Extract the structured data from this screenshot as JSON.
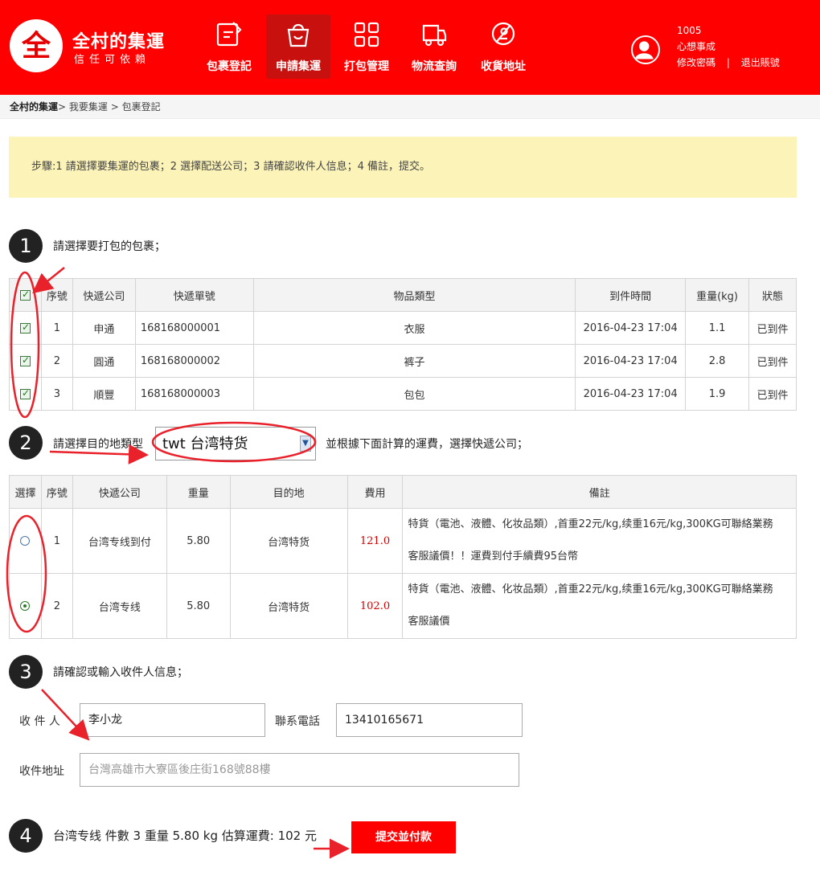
{
  "header": {
    "logo_glyph": "全",
    "logo_title": "全村的集運",
    "logo_slogan": "信任可依賴",
    "nav": [
      {
        "label": "包裹登記",
        "icon": "edit-icon"
      },
      {
        "label": "申請集運",
        "icon": "bag-icon"
      },
      {
        "label": "打包管理",
        "icon": "grid-icon"
      },
      {
        "label": "物流查詢",
        "icon": "truck-icon"
      },
      {
        "label": "收貨地址",
        "icon": "location-icon"
      }
    ],
    "active_nav": "申請集運",
    "user": {
      "id": "1005",
      "motto": "心想事成",
      "change_password": "修改密碼",
      "separator": "|",
      "logout": "退出賬號"
    },
    "avatar_icon": "user-avatar-icon"
  },
  "breadcrumb": {
    "home": "全村的集運",
    "path": "> 我要集運 > 包裹登記"
  },
  "notice": "步驟:1 請選擇要集運的包裹；2 選擇配送公司；3 請確認收件人信息；4 備註，提交。",
  "steps": {
    "s1": {
      "num": "1",
      "text": "請選擇要打包的包裹；"
    },
    "s2": {
      "num": "2",
      "text_before": "請選擇目的地類型",
      "text_after": "並根據下面計算的運費，選擇快遞公司；"
    },
    "s3": {
      "num": "3",
      "text": "請確認或輸入收件人信息；"
    },
    "s4": {
      "num": "4"
    }
  },
  "packages": {
    "headers": [
      "序號",
      "快遞公司",
      "快遞單號",
      "物品類型",
      "到件時間",
      "重量(kg)",
      "狀態"
    ],
    "rows": [
      {
        "no": "1",
        "courier": "申通",
        "tracking": "168168000001",
        "type": "衣服",
        "arrived": "2016-04-23 17:04",
        "weight": "1.1",
        "status": "已到件",
        "checked": true
      },
      {
        "no": "2",
        "courier": "圓通",
        "tracking": "168168000002",
        "type": "裤子",
        "arrived": "2016-04-23 17:04",
        "weight": "2.8",
        "status": "已到件",
        "checked": true
      },
      {
        "no": "3",
        "courier": "順豐",
        "tracking": "168168000003",
        "type": "包包",
        "arrived": "2016-04-23 17:04",
        "weight": "1.9",
        "status": "已到件",
        "checked": true
      }
    ]
  },
  "destination_select": {
    "value": "twt 台湾特货"
  },
  "shipping": {
    "headers": [
      "選擇",
      "序號",
      "快遞公司",
      "重量",
      "目的地",
      "費用",
      "備註"
    ],
    "rows": [
      {
        "no": "1",
        "company": "台湾专线到付",
        "weight": "5.80",
        "dest": "台湾特货",
        "fee": "121.0",
        "note1": "特貨（電池、液體、化妆品類）,首重22元/kg,续重16元/kg,300KG可聯絡業務",
        "note2": "客服議價！！運費到付手續費95台幣",
        "selected": false
      },
      {
        "no": "2",
        "company": "台湾专线",
        "weight": "5.80",
        "dest": "台湾特货",
        "fee": "102.0",
        "note1": "特貨（電池、液體、化妆品類）,首重22元/kg,续重16元/kg,300KG可聯絡業務",
        "note2": "客服議價",
        "selected": true
      }
    ]
  },
  "recipient": {
    "name_label": "收 件 人",
    "name_value": "李小龙",
    "phone_label": "聯系電話",
    "phone_value": "13410165671",
    "address_label": "收件地址",
    "address_placeholder": "台灣高雄市大寮區後庄街168號88樓"
  },
  "summary": {
    "text": "台湾专线 件數 3 重量 5.80 kg 估算運費: 102 元",
    "submit": "提交並付款"
  },
  "colors": {
    "brand_red": "#ff0000",
    "active_nav": "#c8100f",
    "notice_bg": "#fcf3b8",
    "fee_red": "#d40000",
    "annotation_red": "#e8212a"
  }
}
